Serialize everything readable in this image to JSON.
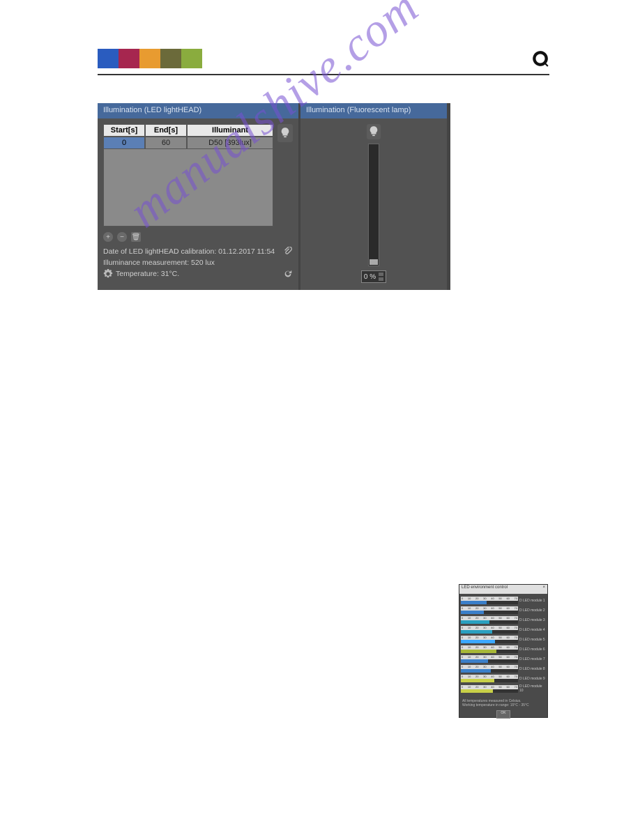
{
  "panel_left": {
    "title": "Illumination (LED lightHEAD)",
    "columns": {
      "start": "Start[s]",
      "end": "End[s]",
      "illuminant": "Illuminant"
    },
    "row": {
      "start": "0",
      "end": "60",
      "illuminant": "D50 [393lux]"
    },
    "calibration": "Date of LED lightHEAD calibration: 01.12.2017 11:54",
    "measurement": "Illuminance measurement: 520 lux",
    "temperature": "Temperature: 31°C."
  },
  "panel_right": {
    "title": "Illumination (Fluorescent lamp)",
    "value": "0 %"
  },
  "watermark": "manualshive.com",
  "small_dialog": {
    "title": "LED environment control",
    "close": "×",
    "rows": [
      {
        "label": "D LED module 1",
        "fill": 45,
        "color": "#3b7fc9"
      },
      {
        "label": "D LED module 2",
        "fill": 40,
        "color": "#3b7fc9"
      },
      {
        "label": "D LED module 3",
        "fill": 50,
        "color": "#2aa0c0"
      },
      {
        "label": "D LED module 4",
        "fill": 55,
        "color": "#2aa0c0"
      },
      {
        "label": "D LED module 5",
        "fill": 60,
        "color": "#3ba8ff"
      },
      {
        "label": "D LED module 6",
        "fill": 62,
        "color": "#a8b838"
      },
      {
        "label": "D LED module 7",
        "fill": 48,
        "color": "#3b7fc9"
      },
      {
        "label": "D LED module 8",
        "fill": 52,
        "color": "#3b7fc9"
      },
      {
        "label": "D LED module 9",
        "fill": 58,
        "color": "#c8d048"
      },
      {
        "label": "D LED module 10",
        "fill": 56,
        "color": "#c8d048"
      }
    ],
    "ticks": [
      "0",
      "10",
      "20",
      "30",
      "40",
      "50",
      "60",
      "70"
    ],
    "footer1": "All temperatures measured in Celsius.",
    "footer2": "Working temperature in range: 15°C - 35°C",
    "ok": "OK"
  }
}
